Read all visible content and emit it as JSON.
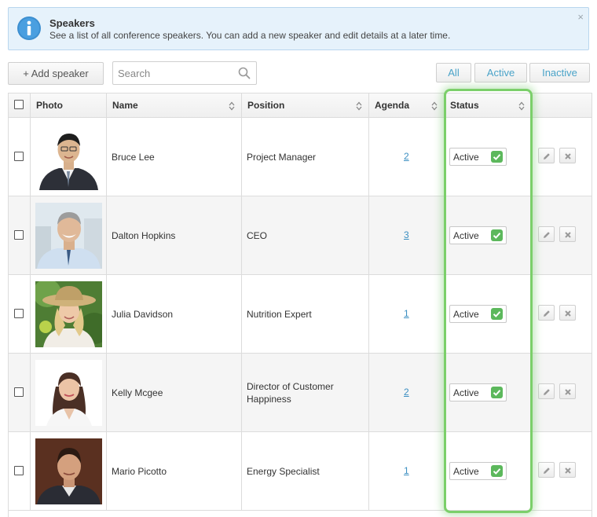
{
  "notice": {
    "title": "Speakers",
    "description": "See a list of all conference speakers. You can add a new speaker and edit details at a later time.",
    "close": "×"
  },
  "toolbar": {
    "add_label": "+ Add speaker",
    "search_placeholder": "Search",
    "filters": [
      "All",
      "Active",
      "Inactive"
    ]
  },
  "table": {
    "headers": {
      "photo": "Photo",
      "name": "Name",
      "position": "Position",
      "agenda": "Agenda",
      "status": "Status"
    },
    "rows": [
      {
        "name": "Bruce Lee",
        "position": "Project Manager",
        "agenda": "2",
        "status": "Active"
      },
      {
        "name": "Dalton Hopkins",
        "position": "CEO",
        "agenda": "3",
        "status": "Active"
      },
      {
        "name": "Julia Davidson",
        "position": "Nutrition Expert",
        "agenda": "1",
        "status": "Active"
      },
      {
        "name": "Kelly Mcgee",
        "position": "Director of Customer Happiness",
        "agenda": "2",
        "status": "Active"
      },
      {
        "name": "Mario Picotto",
        "position": "Energy Specialist",
        "agenda": "1",
        "status": "Active"
      }
    ]
  },
  "colors": {
    "accent_link": "#3c8fc2",
    "status_check": "#5cb85c",
    "highlight": "#7bcf6a",
    "notice_bg": "#e6f2fb"
  }
}
